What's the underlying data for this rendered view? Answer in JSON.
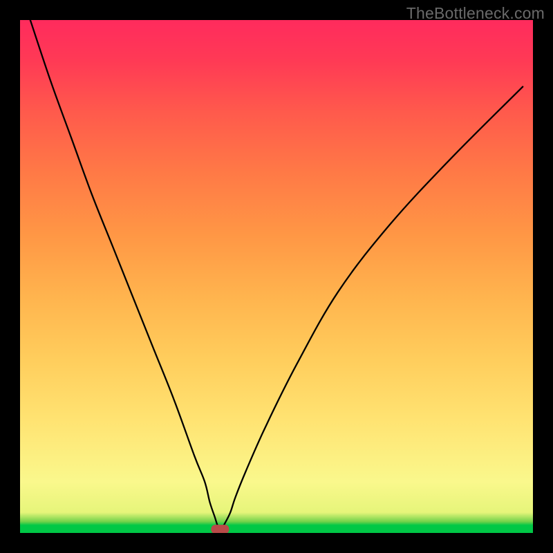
{
  "watermark": "TheBottleneck.com",
  "chart_data": {
    "type": "line",
    "title": "",
    "xlabel": "",
    "ylabel": "",
    "xlim": [
      0,
      100
    ],
    "ylim": [
      0,
      100
    ],
    "grid": false,
    "legend": false,
    "annotations": [],
    "series": [
      {
        "name": "bottleneck-curve",
        "x": [
          2,
          6,
          10,
          14,
          18,
          22,
          26,
          30,
          34,
          36,
          37,
          38,
          38.5,
          39,
          39.5,
          40,
          41,
          42,
          44,
          48,
          54,
          62,
          72,
          84,
          98
        ],
        "y": [
          100,
          88,
          77,
          66,
          56,
          46,
          36,
          26,
          15,
          10,
          6,
          3,
          1.5,
          1,
          1.2,
          2,
          4,
          7,
          12,
          21,
          33,
          47,
          60,
          73,
          87
        ]
      }
    ],
    "marker": {
      "name": "optimal-point",
      "x": 39,
      "y": 0.8,
      "color": "#b94a48"
    },
    "background_gradient_stops": [
      {
        "pos": 0.0,
        "color": "#00c846"
      },
      {
        "pos": 0.015,
        "color": "#00c846"
      },
      {
        "pos": 0.04,
        "color": "#e6f57a"
      },
      {
        "pos": 0.1,
        "color": "#faf88c"
      },
      {
        "pos": 0.34,
        "color": "#ffcd5c"
      },
      {
        "pos": 0.58,
        "color": "#ff9745"
      },
      {
        "pos": 0.82,
        "color": "#ff5a4c"
      },
      {
        "pos": 1.0,
        "color": "#ff2b5d"
      }
    ]
  }
}
